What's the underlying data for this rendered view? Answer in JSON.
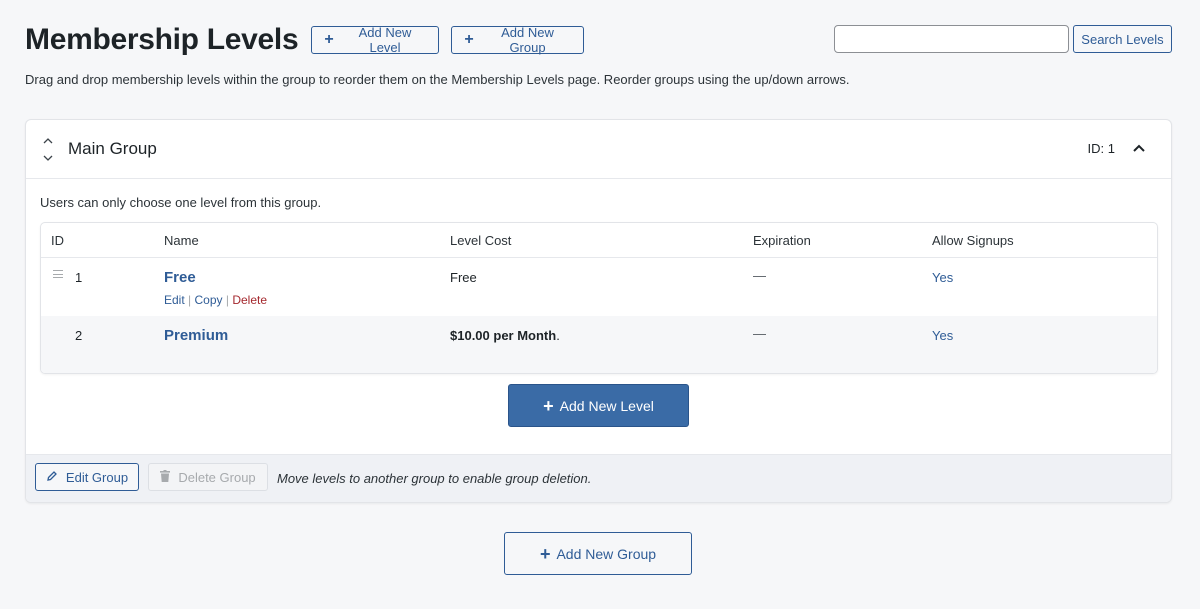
{
  "header": {
    "title": "Membership Levels",
    "add_level_label": "Add New Level",
    "add_group_label": "Add New Group",
    "plus_icon": "+"
  },
  "search": {
    "value": "",
    "placeholder": "",
    "button_label": "Search Levels"
  },
  "intro_text": "Drag and drop membership levels within the group to reorder them on the Membership Levels page. Reorder groups using the up/down arrows.",
  "group": {
    "name": "Main Group",
    "id_label": "ID: 1",
    "up_arrow": "^",
    "down_arrow": "ˇ",
    "description": "Users can only choose one level from this group.",
    "table": {
      "columns": [
        "ID",
        "Name",
        "Level Cost",
        "Expiration",
        "Allow Signups"
      ],
      "rows": [
        {
          "id": "1",
          "name": "Free",
          "cost": "Free",
          "expiration": "—",
          "allow_signups": "Yes",
          "actions": {
            "edit": "Edit",
            "copy": "Copy",
            "delete": "Delete",
            "separator": "|"
          }
        },
        {
          "id": "2",
          "name": "Premium",
          "cost_amount": "$10.00 per Month",
          "cost_suffix": ".",
          "expiration": "—",
          "allow_signups": "Yes"
        }
      ]
    },
    "add_level_label": "Add New Level",
    "footer": {
      "edit_label": "Edit Group",
      "delete_label": "Delete Group",
      "note": "Move levels to another group to enable group deletion."
    }
  },
  "add_group_bottom_label": "Add New Group",
  "colors": {
    "accent": "#2f5c96",
    "primary_button": "#3a6ba6",
    "danger": "#a4282e",
    "background": "#f6f7f9"
  }
}
